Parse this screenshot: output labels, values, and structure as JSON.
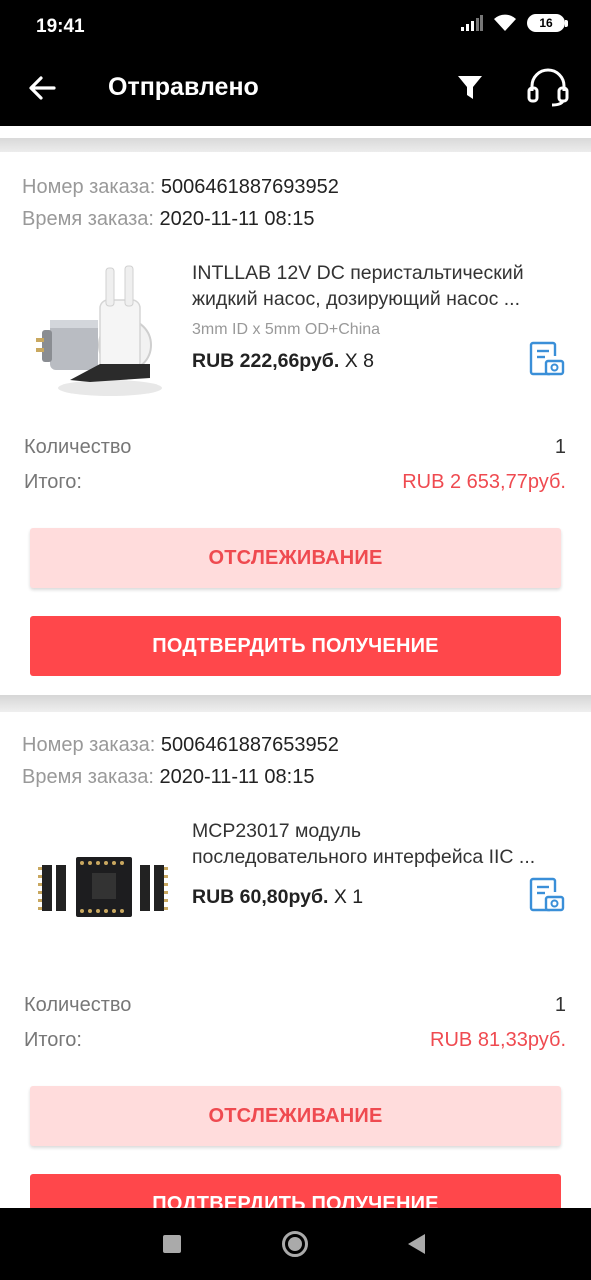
{
  "status_bar": {
    "time": "19:41",
    "battery": "16"
  },
  "header": {
    "title": "Отправлено"
  },
  "orders": [
    {
      "order_label": "Номер заказа:",
      "order_number": "5006461887693952",
      "time_label": "Время заказа:",
      "time_value": "2020-11-11 08:15",
      "product_title_line1": "INTLLAB 12V DC перистальтический",
      "product_title_line2": "жидкий насос, дозирующий насос ...",
      "sku": "3mm ID x 5mm OD+China",
      "price": "RUB 222,66руб.",
      "qty_mult": "X 8",
      "quantity_label": "Количество",
      "quantity_value": "1",
      "total_label": "Итого:",
      "total_value": "RUB 2 653,77руб.",
      "track_label": "ОТСЛЕЖИВАНИЕ",
      "confirm_label": "ПОДТВЕРДИТЬ ПОЛУЧЕНИЕ"
    },
    {
      "order_label": "Номер заказа:",
      "order_number": "5006461887653952",
      "time_label": "Время заказа:",
      "time_value": "2020-11-11 08:15",
      "product_title_line1": "MCP23017 модуль",
      "product_title_line2": "последовательного интерфейса IIC ...",
      "price": "RUB 60,80руб.",
      "qty_mult": "X 1",
      "quantity_label": "Количество",
      "quantity_value": "1",
      "total_label": "Итого:",
      "total_value": "RUB 81,33руб.",
      "track_label": "ОТСЛЕЖИВАНИЕ",
      "confirm_label": "ПОДТВЕРДИТЬ ПОЛУЧЕНИЕ"
    }
  ],
  "colors": {
    "accent": "#ff474b",
    "accent_text": "#ef4a50",
    "track_bg": "#ffdcdc",
    "icon_blue": "#3a8fd8"
  }
}
